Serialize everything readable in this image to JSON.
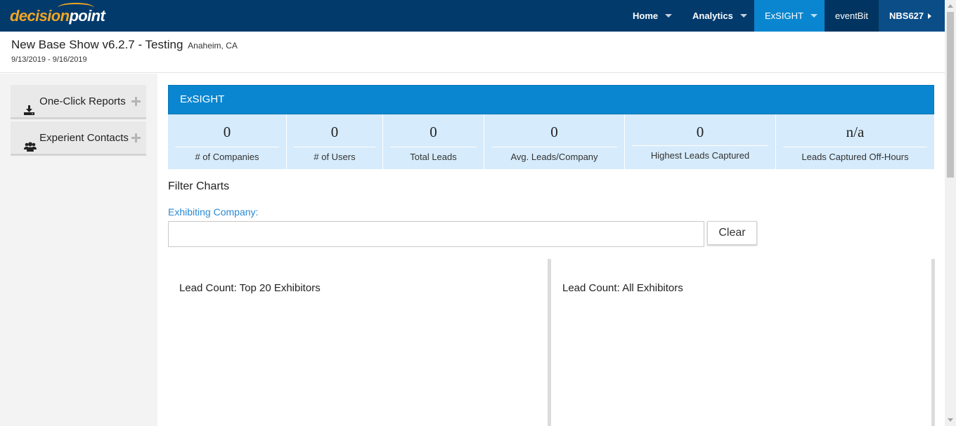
{
  "brand": {
    "part1": "decision",
    "part2": "point"
  },
  "nav": {
    "home": "Home",
    "analytics": "Analytics",
    "exsight": "ExSIGHT",
    "eventbit": "eventBit",
    "user": "NBS627"
  },
  "show": {
    "title": "New Base Show v6.2.7 - Testing",
    "location": "Anaheim, CA",
    "dates": "9/13/2019 - 9/16/2019"
  },
  "sidebar": {
    "items": [
      {
        "label": "One-Click Reports",
        "icon": "download-icon"
      },
      {
        "label": "Experient Contacts",
        "icon": "users-icon"
      }
    ]
  },
  "panel": {
    "title": "ExSIGHT",
    "stats": [
      {
        "value": "0",
        "label": "# of Companies"
      },
      {
        "value": "0",
        "label": "# of Users"
      },
      {
        "value": "0",
        "label": "Total Leads"
      },
      {
        "value": "0",
        "label": "Avg. Leads/Company"
      },
      {
        "value": "0",
        "label": "Highest Leads Captured"
      },
      {
        "value": "n/a",
        "label": "Leads Captured Off-Hours"
      }
    ]
  },
  "filter": {
    "title": "Filter Charts",
    "label": "Exhibiting Company:",
    "value": "",
    "clear_label": "Clear"
  },
  "charts": [
    {
      "title": "Lead Count: Top 20 Exhibitors"
    },
    {
      "title": "Lead Count: All Exhibitors"
    }
  ],
  "colors": {
    "nav_bg": "#023a6c",
    "accent": "#0a86d0",
    "brand_orange": "#f2a521",
    "stats_bg": "#d6ebfb"
  }
}
